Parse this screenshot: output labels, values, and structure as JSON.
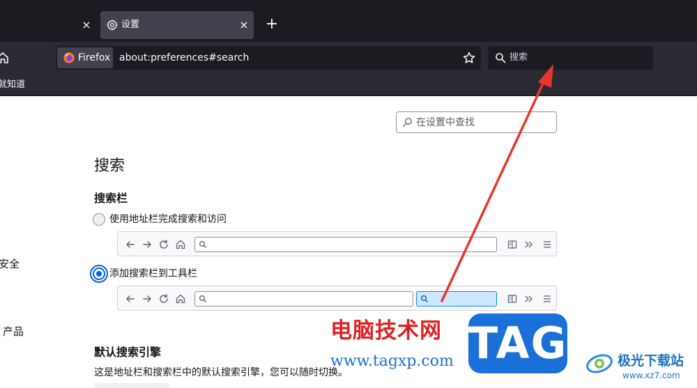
{
  "tabs": {
    "inactive_close": "×",
    "active": {
      "title": "设置",
      "close": "×"
    },
    "new_tab": "+"
  },
  "navbar": {
    "identity_label": "Firefox",
    "url": "about:preferences#search",
    "search_placeholder": "搜索"
  },
  "bookmarks": {
    "item": "就知道"
  },
  "sidebar": {
    "privacy_fragment": "安全",
    "products_fragment": "产品"
  },
  "page": {
    "find_placeholder": "在设置中查找",
    "section_title": "搜索",
    "searchbar_group": {
      "title": "搜索栏",
      "option_urlbar": "使用地址栏完成搜索和访问",
      "option_toolbar": "添加搜索栏到工具栏",
      "selected": "option_toolbar"
    },
    "default_engine": {
      "title": "默认搜索引擎",
      "description": "这是地址栏和搜索栏中的默认搜索引擎，您可以随时切换。"
    }
  },
  "watermarks": {
    "site_cn": "电脑技术网",
    "site_url": "www.tagxp.com",
    "tag": "TAG",
    "jiguang": "极光下载站",
    "jiguang_url": "www.xz7.com"
  },
  "colors": {
    "tabstrip": "#1c1b22",
    "navbar": "#2b2a33",
    "accent": "#0061e0",
    "arrow": "#e8362c",
    "watermark_blue": "#1a6fd8"
  }
}
